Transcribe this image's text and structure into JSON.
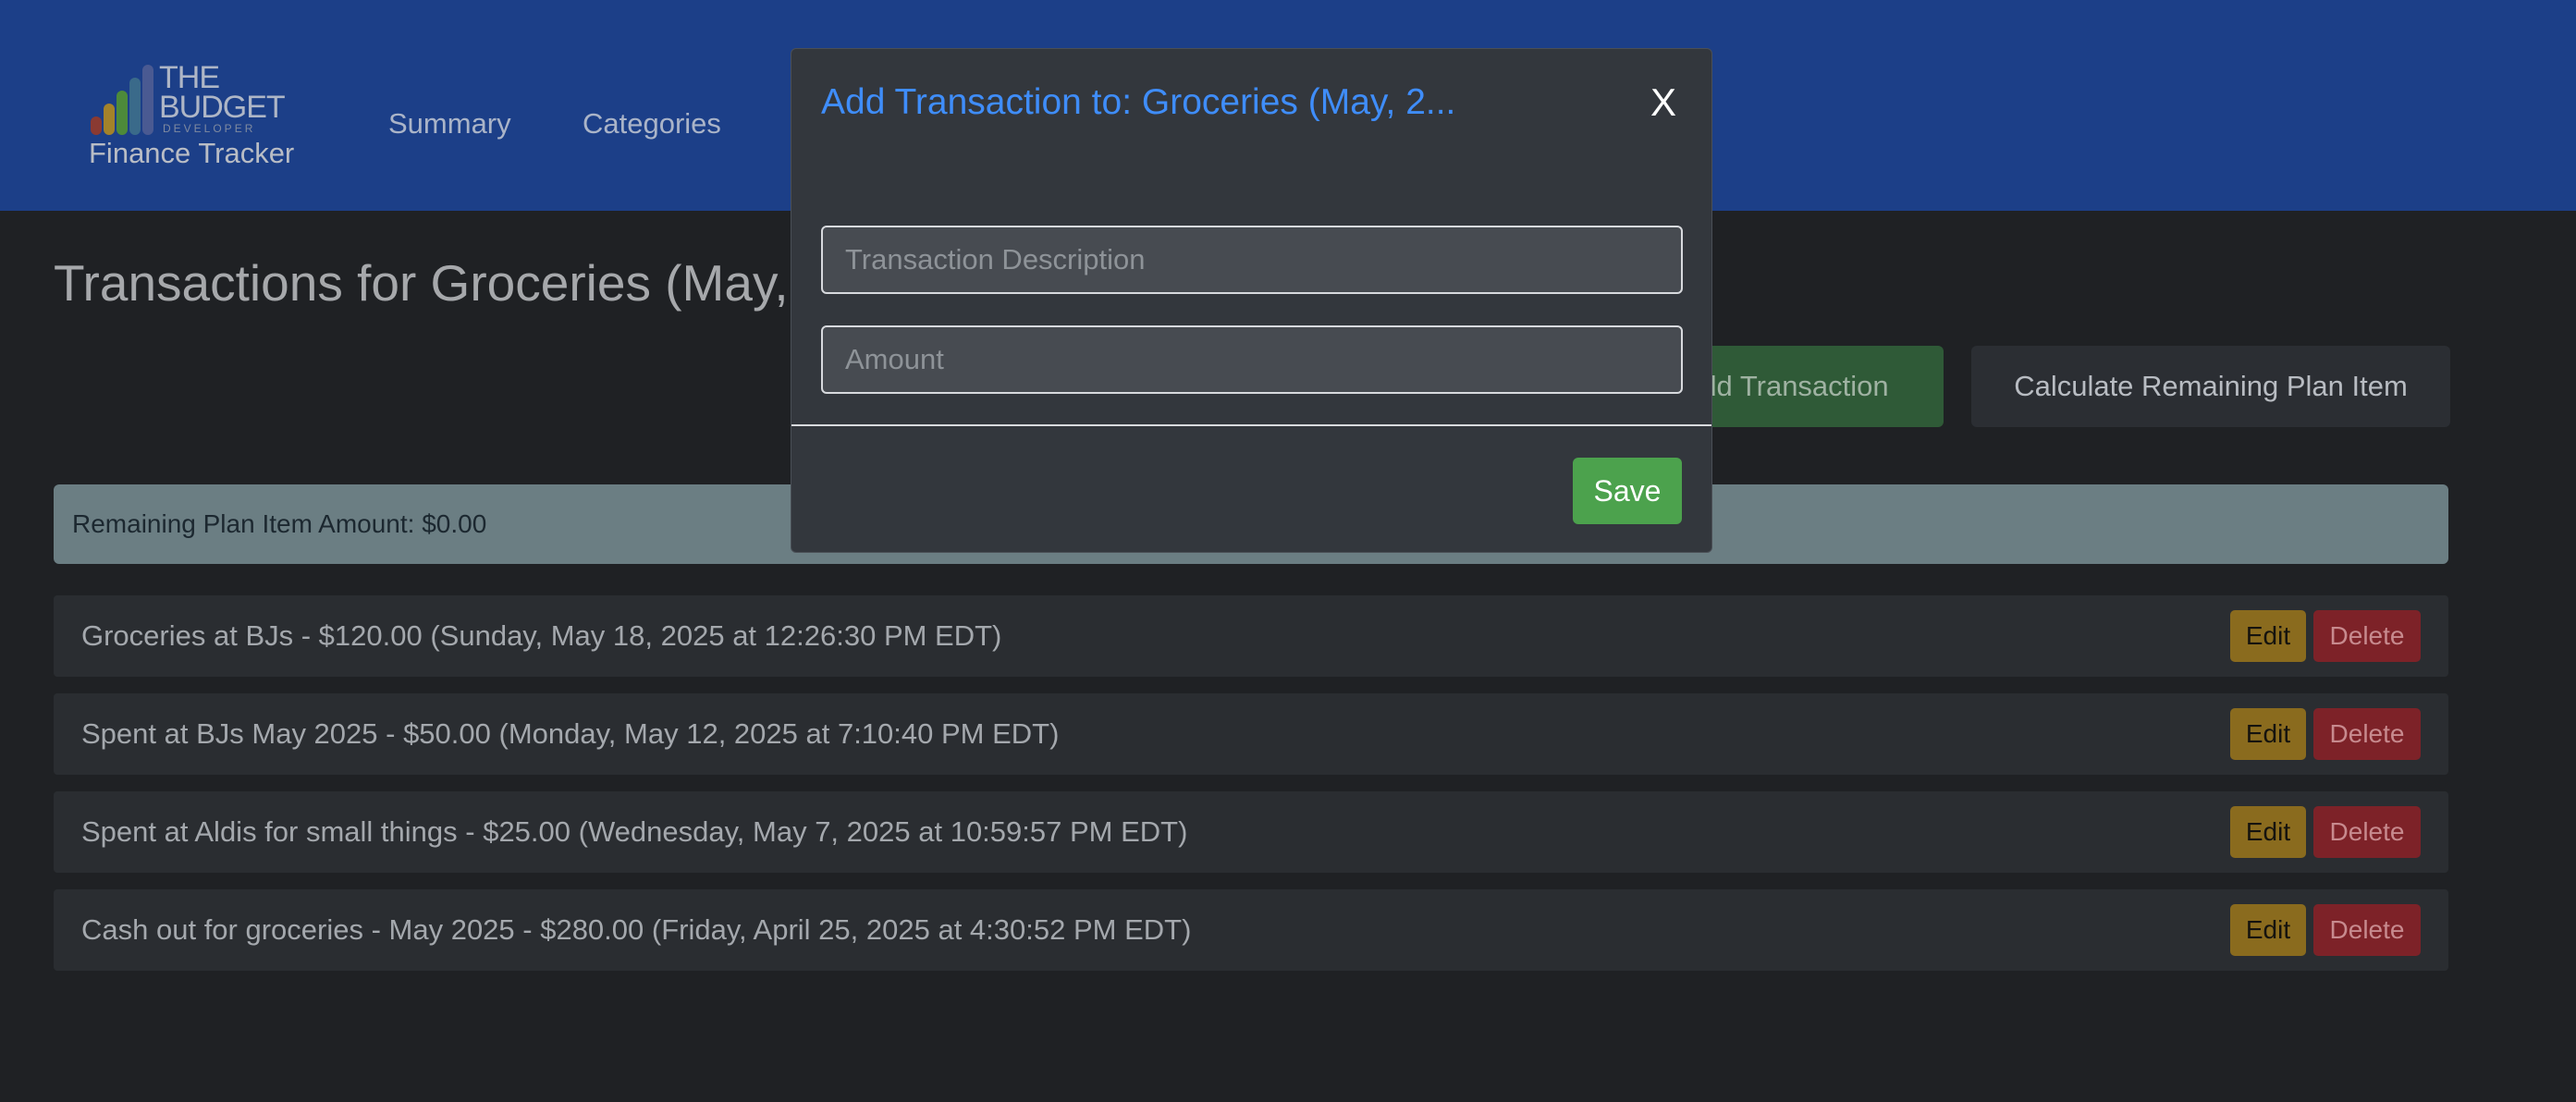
{
  "header": {
    "logo": {
      "line1": "THE",
      "line2": "BUDGET",
      "sub": "DEVELOPER"
    },
    "brand": "Finance Tracker",
    "nav": [
      {
        "label": "Summary"
      },
      {
        "label": "Categories"
      }
    ]
  },
  "page": {
    "title": "Transactions for Groceries (May,",
    "add_transaction_label": "dd Transaction",
    "calculate_label": "Calculate Remaining Plan Item",
    "remaining_alert": "Remaining Plan Item Amount: $0.00"
  },
  "transactions": [
    {
      "text": "Groceries at BJs - $120.00 (Sunday, May 18, 2025 at 12:26:30 PM EDT)",
      "edit": "Edit",
      "delete": "Delete"
    },
    {
      "text": "Spent at BJs May 2025 - $50.00 (Monday, May 12, 2025 at 7:10:40 PM EDT)",
      "edit": "Edit",
      "delete": "Delete"
    },
    {
      "text": "Spent at Aldis for small things - $25.00 (Wednesday, May 7, 2025 at 10:59:57 PM EDT)",
      "edit": "Edit",
      "delete": "Delete"
    },
    {
      "text": "Cash out for groceries - May 2025 - $280.00 (Friday, April 25, 2025 at 4:30:52 PM EDT)",
      "edit": "Edit",
      "delete": "Delete"
    }
  ],
  "modal": {
    "title": "Add Transaction to: Groceries (May, 2...",
    "close": "X",
    "description_placeholder": "Transaction Description",
    "description_value": "",
    "amount_placeholder": "Amount",
    "amount_value": "",
    "save": "Save"
  },
  "colors": {
    "navbar": "#1c3f88",
    "background": "#1f2124",
    "modal_title": "#3f8dfa",
    "save": "#4ca24d",
    "edit": "#8a6b1e",
    "delete": "#7d2228"
  }
}
